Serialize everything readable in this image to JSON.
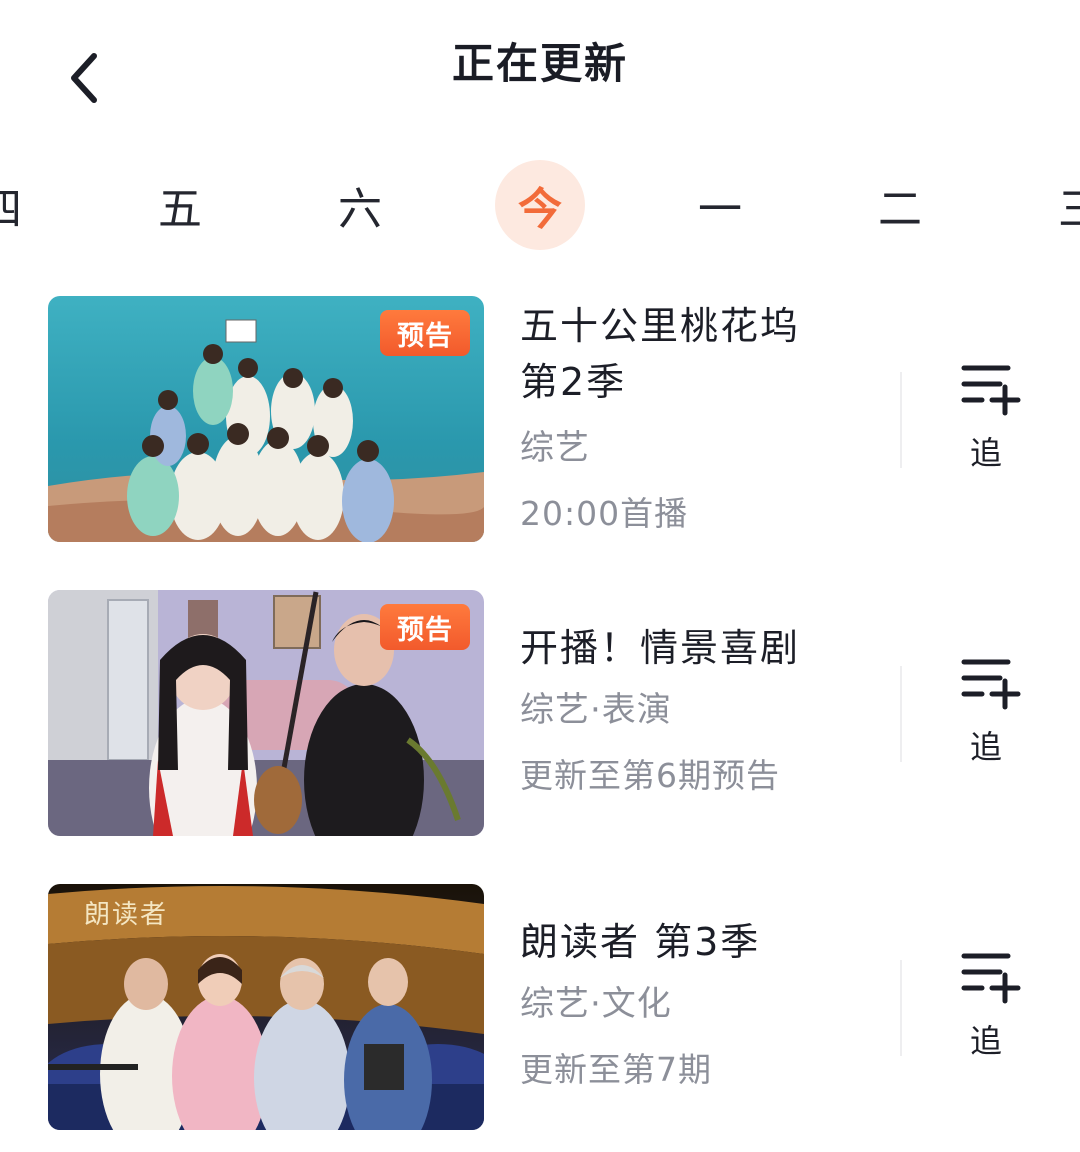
{
  "header": {
    "title": "正在更新"
  },
  "day_tabs": [
    {
      "label": "四",
      "active": false
    },
    {
      "label": "五",
      "active": false
    },
    {
      "label": "六",
      "active": false
    },
    {
      "label": "今",
      "active": true
    },
    {
      "label": "一",
      "active": false
    },
    {
      "label": "二",
      "active": false
    },
    {
      "label": "三",
      "active": false
    }
  ],
  "colors": {
    "accent": "#f26b3a",
    "accent_bg": "#fde9e0",
    "badge": "#f25a2c",
    "secondary_text": "#8c8f99"
  },
  "shows": [
    {
      "title_line1": "五十公里桃花坞",
      "title_line2": "第2季",
      "genre": "综艺",
      "status": "20:00首播",
      "badge": "预告",
      "follow_label": "追"
    },
    {
      "title_line1": "开播！情景喜剧",
      "title_line2": "",
      "genre": "综艺·表演",
      "status": "更新至第6期预告",
      "badge": "预告",
      "follow_label": "追"
    },
    {
      "title_line1": "朗读者 第3季",
      "title_line2": "",
      "genre": "综艺·文化",
      "status": "更新至第7期",
      "badge": "",
      "follow_label": "追",
      "thumb_logo_text": "朗读者"
    }
  ]
}
